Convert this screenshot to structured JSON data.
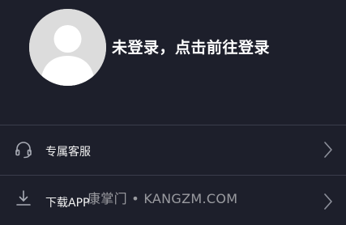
{
  "profile": {
    "login_prompt": "未登录，点击前往登录",
    "avatar_icon": "default-user-avatar-icon"
  },
  "menu": {
    "items": [
      {
        "label": "专属客服",
        "icon": "headset-icon",
        "chevron_icon": "chevron-right-icon"
      },
      {
        "label": "下载APP",
        "icon": "download-icon",
        "chevron_icon": "chevron-right-icon"
      }
    ]
  },
  "watermark": {
    "text": "康掌门 • KANGZM.COM"
  },
  "colors": {
    "background": "#1d1f2b",
    "divider": "#3a3d4b",
    "avatar_bg": "#dcdcdc",
    "text": "#ffffff",
    "icon": "#a9acb6"
  }
}
